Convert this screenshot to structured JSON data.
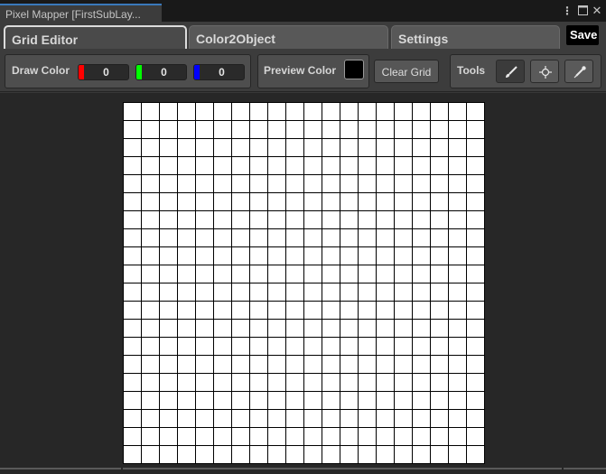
{
  "window": {
    "title": "Pixel Mapper [FirstSubLay...",
    "controls": {
      "menu_icon": "kebab-menu-icon",
      "maximize_icon": "maximize-icon",
      "close_icon": "close-icon"
    }
  },
  "tabs": [
    {
      "label": "Grid Editor",
      "active": true
    },
    {
      "label": "Color2Object",
      "active": false
    },
    {
      "label": "Settings",
      "active": false
    }
  ],
  "save_label": "Save",
  "draw_color": {
    "label": "Draw Color",
    "r": "0",
    "g": "0",
    "b": "0",
    "channel_colors": {
      "r": "#ff0000",
      "g": "#00ff00",
      "b": "#0000ff"
    }
  },
  "preview_color": {
    "label": "Preview Color",
    "value": "#000000"
  },
  "clear_grid_label": "Clear Grid",
  "tools": {
    "label": "Tools",
    "items": [
      {
        "icon": "paint-brush-icon",
        "active": true
      },
      {
        "icon": "crosshair-icon",
        "active": false
      },
      {
        "icon": "eyedropper-icon",
        "active": false
      }
    ]
  },
  "grid": {
    "columns": 20,
    "rows": 20,
    "cell_color": "#ffffff",
    "line_color": "#000000"
  }
}
